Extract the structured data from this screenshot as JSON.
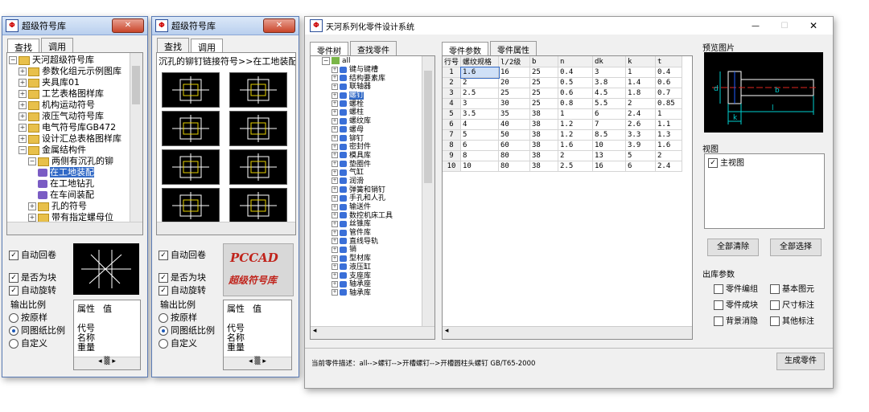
{
  "win1": {
    "title": "超级符号库",
    "close": "✕",
    "tabs": [
      "查找",
      "调用"
    ],
    "tree": [
      {
        "label": "天河超级符号库",
        "exp": "−"
      },
      {
        "label": "参数化组元示例图库",
        "exp": "+"
      },
      {
        "label": "夹具库01",
        "exp": "+"
      },
      {
        "label": "工艺表格图样库",
        "exp": "+"
      },
      {
        "label": "机构运动符号",
        "exp": "+"
      },
      {
        "label": "液压气动符号库",
        "exp": "+"
      },
      {
        "label": "电气符号库GB472",
        "exp": "+"
      },
      {
        "label": "设计汇总表格图样库",
        "exp": "+"
      },
      {
        "label": "金属结构件",
        "exp": "−"
      },
      {
        "label": "两侧有沉孔的铆",
        "exp": "−"
      },
      {
        "label": "在工地装配",
        "exp": ""
      },
      {
        "label": "在工地钻孔",
        "exp": ""
      },
      {
        "label": "在车间装配",
        "exp": ""
      },
      {
        "label": "孔的符号",
        "exp": "+"
      },
      {
        "label": "带有指定螺母位",
        "exp": "+"
      }
    ],
    "auto_roll": "自动回卷",
    "is_block": "是否为块",
    "auto_rotate": "自动旋转",
    "scale_title": "输出比例",
    "scale_options": [
      "按原样",
      "同图纸比例",
      "自定义"
    ],
    "prop_headers": [
      "属性",
      "值"
    ],
    "props": [
      "代号",
      "名称",
      "重量"
    ]
  },
  "win2": {
    "title": "超级符号库",
    "close": "✕",
    "tabs": [
      "查找",
      "调用"
    ],
    "path": "沉孔的铆钉链接符号>>在工地装配",
    "auto_roll": "自动回卷",
    "is_block": "是否为块",
    "auto_rotate": "自动旋转",
    "scale_title": "输出比例",
    "scale_options": [
      "按原样",
      "同图纸比例",
      "自定义"
    ],
    "logo1": "PCCAD",
    "logo2": "超级符号库",
    "prop_headers": [
      "属性",
      "值"
    ],
    "props": [
      "代号",
      "名称",
      "重量"
    ]
  },
  "win3": {
    "title": "天河系列化零件设计系统",
    "left_tabs": [
      "零件树",
      "查找零件"
    ],
    "tree_root": "all",
    "tree_items": [
      "键与键槽",
      "结构要素库",
      "联轴器",
      "螺钉",
      "螺栓",
      "螺柱",
      "螺纹库",
      "螺母",
      "铆钉",
      "密封件",
      "模具库",
      "垫圈件",
      "气缸",
      "润滑",
      "弹簧和销钉",
      "手孔和人孔",
      "输送件",
      "数控机床工具",
      "丝锥库",
      "管件库",
      "直线导轨",
      "销",
      "型材库",
      "液压缸",
      "支座库",
      "轴承座",
      "轴承库"
    ],
    "selected_item": "螺钉",
    "mid_tabs": [
      "零件参数",
      "零件属性"
    ],
    "grid_headers": [
      "行号",
      "螺纹规格",
      "l/2级",
      "b",
      "n",
      "dk",
      "k",
      "t"
    ],
    "grid_rows": [
      [
        "1",
        "1.6",
        "16",
        "25",
        "0.4",
        "3",
        "1",
        "0.4"
      ],
      [
        "2",
        "2",
        "20",
        "25",
        "0.5",
        "3.8",
        "1.4",
        "0.6"
      ],
      [
        "3",
        "2.5",
        "25",
        "25",
        "0.6",
        "4.5",
        "1.8",
        "0.7"
      ],
      [
        "4",
        "3",
        "30",
        "25",
        "0.8",
        "5.5",
        "2",
        "0.85"
      ],
      [
        "5",
        "3.5",
        "35",
        "38",
        "1",
        "6",
        "2.4",
        "1"
      ],
      [
        "6",
        "4",
        "40",
        "38",
        "1.2",
        "7",
        "2.6",
        "1.1"
      ],
      [
        "7",
        "5",
        "50",
        "38",
        "1.2",
        "8.5",
        "3.3",
        "1.3"
      ],
      [
        "8",
        "6",
        "60",
        "38",
        "1.6",
        "10",
        "3.9",
        "1.6"
      ],
      [
        "9",
        "8",
        "80",
        "38",
        "2",
        "13",
        "5",
        "2"
      ],
      [
        "10",
        "10",
        "80",
        "38",
        "2.5",
        "16",
        "6",
        "2.4"
      ]
    ],
    "preview_title": "预览图片",
    "view_title": "视图",
    "view_item": "主视图",
    "clear_all": "全部清除",
    "select_all": "全部选择",
    "output_title": "出库参数",
    "outputs": [
      "零件编组",
      "基本图元",
      "零件成块",
      "尺寸标注",
      "背景消隐",
      "其他标注"
    ],
    "status": "当前零件描述：all-->螺钉-->开槽螺钉-->开槽圆柱头螺钉 GB/T65-2000",
    "generate": "生成零件",
    "min": "—",
    "max": "☐",
    "close": "✕"
  }
}
